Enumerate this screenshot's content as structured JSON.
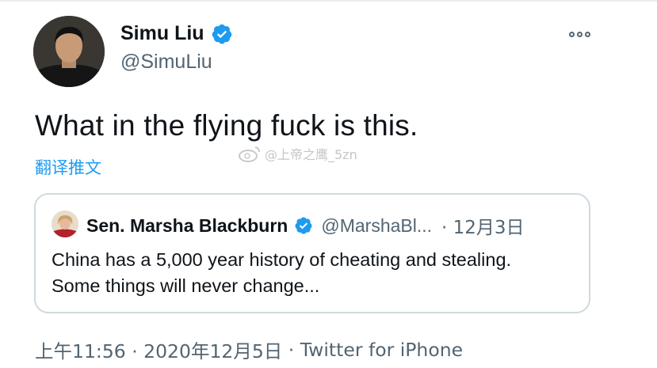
{
  "tweet": {
    "author": {
      "display_name": "Simu Liu",
      "handle": "@SimuLiu",
      "verified": true
    },
    "text": "What in the flying fuck is this.",
    "translate_label": "翻译推文",
    "timestamp": "上午11:56 · 2020年12月5日",
    "source_separator": " · ",
    "source": "Twitter for iPhone",
    "more_icon": "more-options-icon"
  },
  "quoted_tweet": {
    "display_name": "Sen. Marsha Blackburn",
    "handle": "@MarshaBl...",
    "date": "· 12月3日",
    "verified": true,
    "text_line1": "China has a 5,000 year history of cheating and stealing.",
    "text_line2": "Some things will never change..."
  },
  "watermark": {
    "text": "@上帝之鹰_5zn"
  },
  "colors": {
    "accent": "#1d9bf0",
    "text_primary": "#0f1419",
    "text_secondary": "#536471",
    "border": "#cfd9de"
  }
}
